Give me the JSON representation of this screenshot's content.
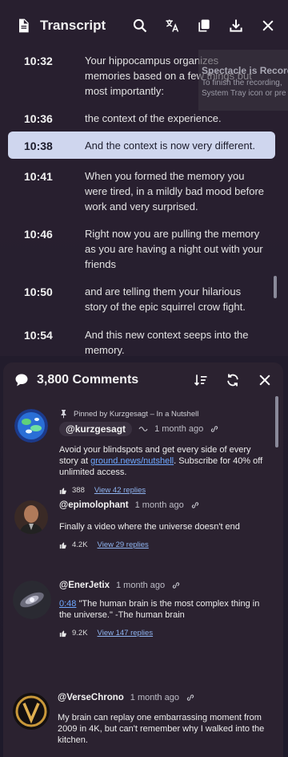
{
  "transcript": {
    "title": "Transcript",
    "segments": [
      {
        "time": "10:32",
        "text": "Your hippocampus organizes memories based on a few things but most importantly:"
      },
      {
        "time": "10:36",
        "text": "the context of the experience."
      },
      {
        "time": "10:38",
        "text": "And the context is now very different."
      },
      {
        "time": "10:41",
        "text": "When you formed the memory you were tired, in a mildly bad mood before work and very surprised."
      },
      {
        "time": "10:46",
        "text": "Right now you are pulling the memory as you are having a night out with your friends"
      },
      {
        "time": "10:50",
        "text": "and are telling them your hilarious story of the epic squirrel crow fight."
      },
      {
        "time": "10:54",
        "text": "And this new context seeps into the memory."
      }
    ],
    "notification": {
      "title": "Spectacle is Recording",
      "line1": "To finish the recording,",
      "line2": "System Tray icon or pre"
    }
  },
  "comments": {
    "title": "3,800 Comments",
    "items": [
      {
        "pinned": "Pinned by Kurzgesagt – In a Nutshell",
        "author": "@kurzgesagt",
        "time": "1 month ago",
        "text_pre": "Avoid your blindspots and get every side of every story at ",
        "link": "ground.news/nutshell",
        "text_post": ". Subscribe for 40% off unlimited access.",
        "likes": "388",
        "replies": "View 42 replies"
      },
      {
        "author": "@epimolophant",
        "time": "1 month ago",
        "text": "Finally a video where the universe doesn't end",
        "likes": "4.2K",
        "replies": "View 29 replies"
      },
      {
        "author": "@EnerJetix",
        "time": "1 month ago",
        "timestamp": "0:48",
        "text": " \"The human brain is the most complex thing in the universe.\" -The human brain",
        "likes": "9.2K",
        "replies": "View 147 replies"
      },
      {
        "author": "@VerseChrono",
        "time": "1 month ago",
        "text": "My brain can replay one embarrassing moment from 2009 in 4K, but can't remember why I walked into the kitchen."
      }
    ]
  },
  "colors": {
    "active_segment": "#cfd6ee",
    "link": "#6ea8ff",
    "panel": "#2b2230"
  }
}
